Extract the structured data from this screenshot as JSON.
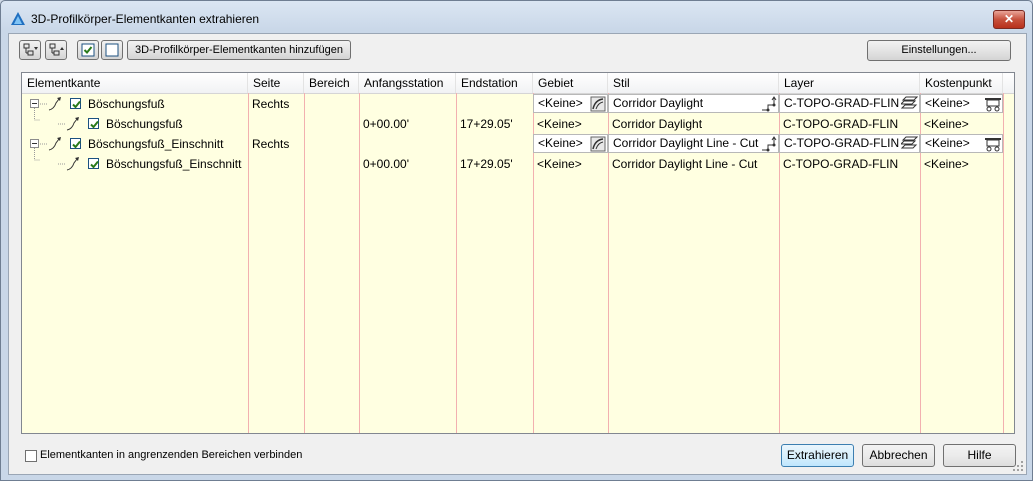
{
  "window": {
    "title": "3D-Profilkörper-Elementkanten extrahieren",
    "close_label": "✕"
  },
  "toolbar": {
    "add_button_label": "3D-Profilkörper-Elementkanten hinzufügen",
    "settings_button_label": "Einstellungen..."
  },
  "table": {
    "columns": [
      "Elementkante",
      "Seite",
      "Bereich",
      "Anfangsstation",
      "Endstation",
      "Gebiet",
      "Stil",
      "Layer",
      "Kostenpunkt"
    ],
    "rows": [
      {
        "name": "Böschungsfuß",
        "seite": "Rechts",
        "bereich": "",
        "start": "",
        "end": "",
        "gebiet": "<Keine>",
        "stil": "Corridor Daylight",
        "layer": "C-TOPO-GRAD-FLIN",
        "kostenpunkt": "<Keine>",
        "checked": true
      },
      {
        "name": "Böschungsfuß",
        "seite": "",
        "bereich": "",
        "start": "0+00.00'",
        "end": "17+29.05'",
        "gebiet": "<Keine>",
        "stil": "Corridor Daylight",
        "layer": "C-TOPO-GRAD-FLIN",
        "kostenpunkt": "<Keine>",
        "checked": true
      },
      {
        "name": "Böschungsfuß_Einschnitt",
        "seite": "Rechts",
        "bereich": "",
        "start": "",
        "end": "",
        "gebiet": "<Keine>",
        "stil": "Corridor Daylight Line - Cut",
        "layer": "C-TOPO-GRAD-FLIN",
        "kostenpunkt": "<Keine>",
        "checked": true
      },
      {
        "name": "Böschungsfuß_Einschnitt",
        "seite": "",
        "bereich": "",
        "start": "0+00.00'",
        "end": "17+29.05'",
        "gebiet": "<Keine>",
        "stil": "Corridor Daylight Line - Cut",
        "layer": "C-TOPO-GRAD-FLIN",
        "kostenpunkt": "<Keine>",
        "checked": true
      }
    ]
  },
  "footer": {
    "connect_label": "Elementkanten in angrenzenden Bereichen verbinden",
    "connect_checked": false,
    "extract_label": "Extrahieren",
    "cancel_label": "Abbrechen",
    "help_label": "Hilfe"
  },
  "colors": {
    "grid_background": "#ffffe1",
    "grid_line": "#f2b0b0",
    "accent": "#3c7fb1"
  }
}
